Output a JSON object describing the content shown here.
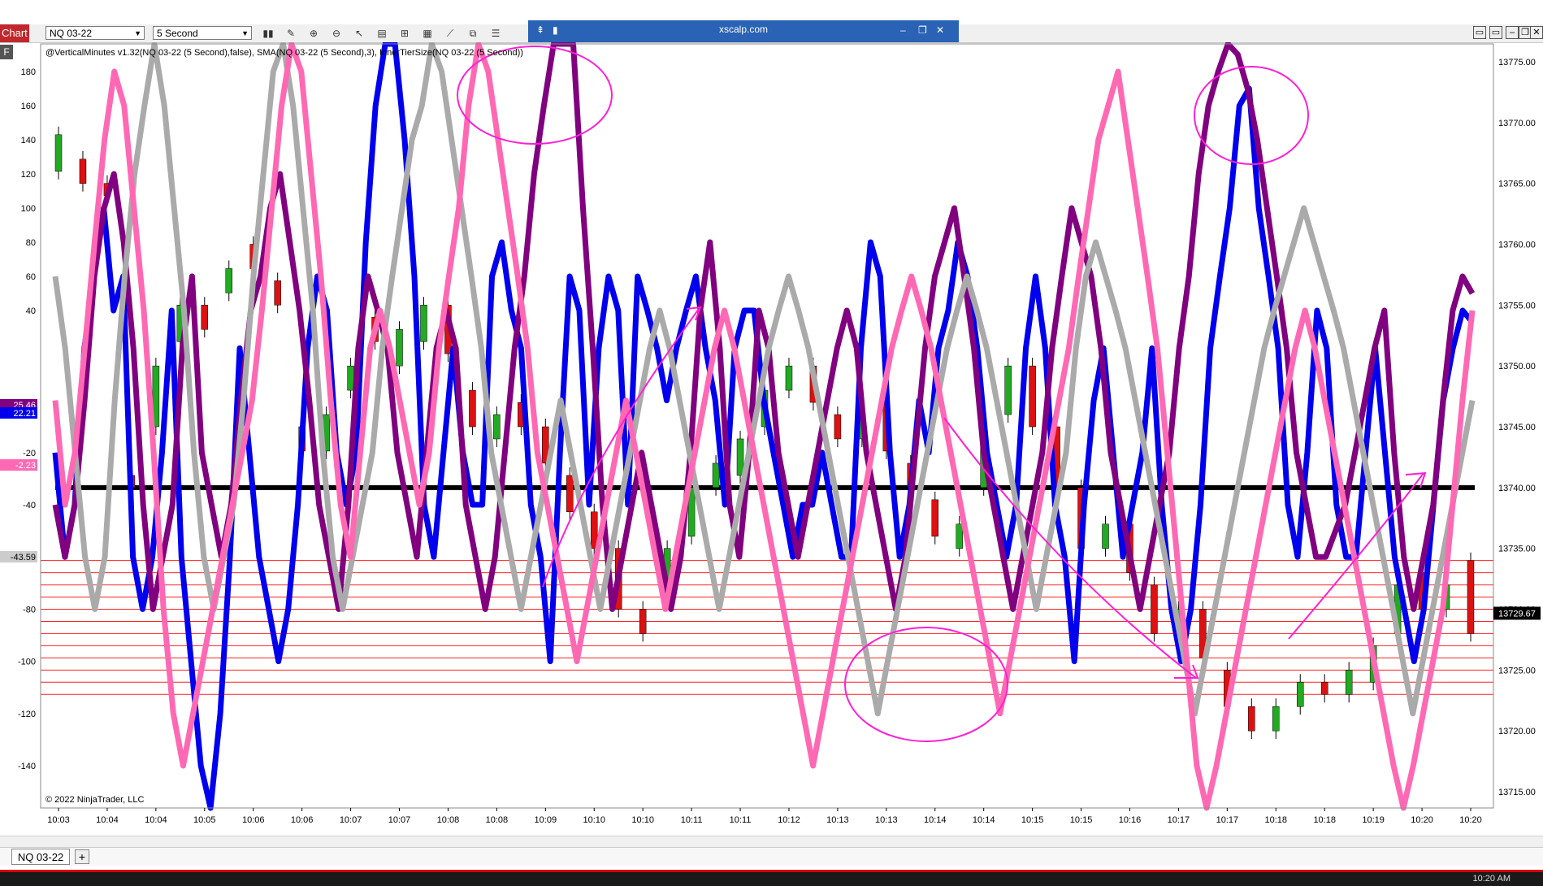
{
  "toolbar": {
    "tab_label": "Chart",
    "instrument": "NQ 03-22",
    "interval": "5 Second"
  },
  "window": {
    "title": "xscalp.com"
  },
  "indicator_label": "@VerticalMinutes v1.32(NQ 03-22 (5 Second),false), SMA(NQ 03-22 (5 Second),3), InnerTierSize(NQ 03-22 (5 Second))",
  "copyright": "© 2022 NinjaTrader, LLC",
  "footer": {
    "instrument_tab": "NQ 03-22",
    "add_tab": "+",
    "clock": "10:20 AM"
  },
  "chart_data": {
    "type": "line",
    "left_axis": {
      "ticks": [
        180,
        160,
        140,
        120,
        100,
        80,
        60,
        40,
        -20,
        -40,
        -60,
        -80,
        -100,
        -120,
        -140
      ]
    },
    "right_axis": {
      "ticks": [
        "13775.00",
        "13770.00",
        "13765.00",
        "13760.00",
        "13755.00",
        "13750.00",
        "13745.00",
        "13740.00",
        "13735.00",
        "13730.00",
        "13725.00",
        "13720.00",
        "13715.00"
      ]
    },
    "x_labels": [
      "10:03",
      "10:04",
      "10:04",
      "10:05",
      "10:06",
      "10:06",
      "10:07",
      "10:07",
      "10:08",
      "10:08",
      "10:09",
      "10:10",
      "10:10",
      "10:11",
      "10:11",
      "10:12",
      "10:13",
      "10:13",
      "10:14",
      "10:14",
      "10:15",
      "10:15",
      "10:16",
      "10:17",
      "10:17",
      "10:18",
      "10:18",
      "10:19",
      "10:20",
      "10:20"
    ],
    "markers": {
      "left": [
        "25.46",
        "22.21",
        "-2.23",
        "-43.59"
      ],
      "right": "13729.67"
    },
    "series": [
      {
        "color": "#0000ee",
        "values": [
          -20,
          -60,
          -40,
          20,
          60,
          100,
          40,
          60,
          -60,
          -80,
          -60,
          -20,
          40,
          -60,
          -100,
          -140,
          -160,
          -120,
          -60,
          20,
          -20,
          -60,
          -80,
          -100,
          -80,
          -40,
          20,
          60,
          40,
          -20,
          -40,
          -20,
          80,
          160,
          200,
          200,
          140,
          60,
          -40,
          -60,
          -20,
          20,
          -20,
          -40,
          -40,
          60,
          80,
          40,
          20,
          -40,
          -60,
          -100,
          -20,
          60,
          40,
          -40,
          20,
          60,
          40,
          -40,
          60,
          40,
          20,
          0,
          20,
          40,
          60,
          20,
          0,
          -40,
          20,
          40,
          40,
          0,
          -20,
          -40,
          -60,
          -40,
          -40,
          -20,
          -40,
          -60,
          -60,
          20,
          80,
          60,
          -20,
          -60,
          -40,
          0,
          -20,
          20,
          40,
          80,
          60,
          20,
          -20,
          -40,
          -60,
          -40,
          20,
          60,
          20,
          -40,
          -60,
          -100,
          -40,
          0,
          20,
          -20,
          -60,
          -40,
          -20,
          20,
          -40,
          -80,
          -100,
          -80,
          -40,
          20,
          60,
          100,
          160,
          170,
          100,
          60,
          20,
          -40,
          -60,
          -20,
          40,
          20,
          -40,
          -60,
          -60,
          -20,
          20,
          -20,
          -60,
          -80,
          -100,
          -80,
          -40,
          0,
          20,
          40,
          30
        ]
      },
      {
        "color": "#800080",
        "values": [
          -40,
          -60,
          -40,
          0,
          60,
          100,
          120,
          80,
          20,
          -40,
          -80,
          -60,
          -40,
          20,
          60,
          -20,
          -40,
          -60,
          -40,
          0,
          40,
          60,
          100,
          120,
          80,
          40,
          0,
          -40,
          -60,
          -80,
          -40,
          20,
          60,
          40,
          20,
          -20,
          -40,
          -60,
          -20,
          20,
          40,
          20,
          -40,
          -60,
          -80,
          -60,
          -20,
          20,
          60,
          120,
          160,
          200,
          220,
          200,
          100,
          20,
          -40,
          -80,
          -60,
          -40,
          -20,
          -40,
          -60,
          -80,
          -60,
          -20,
          40,
          80,
          20,
          -40,
          -60,
          -20,
          40,
          20,
          -20,
          -40,
          -60,
          -40,
          -20,
          0,
          20,
          40,
          20,
          -20,
          -40,
          -60,
          -80,
          -60,
          -20,
          20,
          60,
          80,
          100,
          60,
          20,
          -20,
          -40,
          -60,
          -80,
          -60,
          -40,
          -20,
          20,
          60,
          100,
          80,
          60,
          20,
          -20,
          -40,
          -60,
          -80,
          -60,
          -40,
          -20,
          20,
          60,
          120,
          160,
          180,
          200,
          190,
          170,
          140,
          100,
          60,
          20,
          -20,
          -40,
          -60,
          -60,
          -50,
          -40,
          -20,
          0,
          20,
          40,
          -20,
          -60,
          -80,
          -60,
          -40,
          0,
          40,
          60,
          50
        ]
      },
      {
        "color": "#aaaaaa",
        "values": [
          60,
          20,
          -20,
          -60,
          -80,
          -60,
          0,
          60,
          120,
          160,
          200,
          160,
          100,
          40,
          -20,
          -60,
          -80,
          -60,
          -40,
          0,
          60,
          120,
          180,
          200,
          160,
          100,
          40,
          -20,
          -60,
          -80,
          -60,
          -40,
          -20,
          20,
          60,
          100,
          140,
          160,
          200,
          180,
          140,
          100,
          60,
          20,
          -20,
          -40,
          -60,
          -80,
          -60,
          -40,
          -20,
          0,
          -20,
          -40,
          -60,
          -80,
          -60,
          -40,
          -20,
          0,
          20,
          40,
          20,
          0,
          -20,
          -40,
          -60,
          -80,
          -60,
          -40,
          -20,
          0,
          20,
          40,
          60,
          40,
          20,
          0,
          -20,
          -40,
          -60,
          -80,
          -100,
          -120,
          -100,
          -80,
          -60,
          -40,
          -20,
          0,
          20,
          40,
          60,
          40,
          20,
          0,
          -20,
          -40,
          -60,
          -80,
          -60,
          -40,
          -20,
          20,
          60,
          80,
          60,
          40,
          20,
          0,
          -20,
          -40,
          -60,
          -80,
          -100,
          -120,
          -100,
          -80,
          -60,
          -40,
          -20,
          0,
          20,
          40,
          60,
          80,
          100,
          80,
          60,
          40,
          20,
          0,
          -20,
          -40,
          -60,
          -80,
          -100,
          -120,
          -100,
          -80,
          -60,
          -40,
          -20,
          0
        ]
      },
      {
        "color": "#ff69b4",
        "values": [
          0,
          -40,
          -20,
          20,
          80,
          140,
          180,
          160,
          100,
          40,
          -20,
          -80,
          -120,
          -140,
          -120,
          -100,
          -80,
          -60,
          -40,
          -20,
          0,
          40,
          100,
          160,
          200,
          180,
          120,
          60,
          0,
          -40,
          -60,
          -20,
          20,
          40,
          20,
          0,
          -20,
          -40,
          -20,
          20,
          60,
          100,
          160,
          200,
          180,
          140,
          100,
          60,
          20,
          -20,
          -40,
          -60,
          -80,
          -100,
          -80,
          -60,
          -40,
          -20,
          0,
          -20,
          -40,
          -60,
          -80,
          -60,
          -40,
          -20,
          0,
          20,
          40,
          20,
          0,
          -20,
          -40,
          -60,
          -80,
          -100,
          -120,
          -140,
          -120,
          -100,
          -80,
          -60,
          -40,
          -20,
          0,
          20,
          40,
          60,
          40,
          20,
          0,
          -20,
          -40,
          -60,
          -80,
          -100,
          -120,
          -100,
          -80,
          -60,
          -40,
          -20,
          0,
          20,
          60,
          100,
          140,
          160,
          180,
          140,
          100,
          60,
          20,
          -20,
          -60,
          -100,
          -140,
          -160,
          -140,
          -120,
          -100,
          -80,
          -60,
          -40,
          -20,
          0,
          20,
          40,
          20,
          0,
          -20,
          -40,
          -60,
          -80,
          -100,
          -120,
          -140,
          -160,
          -140,
          -120,
          -100,
          -80,
          -40,
          0,
          40
        ]
      }
    ],
    "candles": [
      {
        "o": 13766,
        "c": 13769
      },
      {
        "o": 13767,
        "c": 13765
      },
      {
        "o": 13765,
        "c": 13764
      },
      {
        "o": 13741,
        "c": 13740
      },
      {
        "o": 13745,
        "c": 13750
      },
      {
        "o": 13752,
        "c": 13755
      },
      {
        "o": 13755,
        "c": 13753
      },
      {
        "o": 13756,
        "c": 13758
      },
      {
        "o": 13760,
        "c": 13758
      },
      {
        "o": 13757,
        "c": 13755
      },
      {
        "o": 13745,
        "c": 13743
      },
      {
        "o": 13743,
        "c": 13746
      },
      {
        "o": 13748,
        "c": 13750
      },
      {
        "o": 13754,
        "c": 13752
      },
      {
        "o": 13750,
        "c": 13753
      },
      {
        "o": 13752,
        "c": 13755
      },
      {
        "o": 13755,
        "c": 13751
      },
      {
        "o": 13748,
        "c": 13745
      },
      {
        "o": 13744,
        "c": 13746
      },
      {
        "o": 13747,
        "c": 13745
      },
      {
        "o": 13745,
        "c": 13742
      },
      {
        "o": 13741,
        "c": 13738
      },
      {
        "o": 13738,
        "c": 13735
      },
      {
        "o": 13735,
        "c": 13730
      },
      {
        "o": 13730,
        "c": 13728
      },
      {
        "o": 13732,
        "c": 13735
      },
      {
        "o": 13736,
        "c": 13740
      },
      {
        "o": 13740,
        "c": 13742
      },
      {
        "o": 13741,
        "c": 13744
      },
      {
        "o": 13745,
        "c": 13748
      },
      {
        "o": 13748,
        "c": 13750
      },
      {
        "o": 13750,
        "c": 13747
      },
      {
        "o": 13746,
        "c": 13744
      },
      {
        "o": 13744,
        "c": 13746
      },
      {
        "o": 13747,
        "c": 13743
      },
      {
        "o": 13742,
        "c": 13740
      },
      {
        "o": 13739,
        "c": 13736
      },
      {
        "o": 13735,
        "c": 13737
      },
      {
        "o": 13740,
        "c": 13745
      },
      {
        "o": 13746,
        "c": 13750
      },
      {
        "o": 13750,
        "c": 13745
      },
      {
        "o": 13745,
        "c": 13740
      },
      {
        "o": 13740,
        "c": 13735
      },
      {
        "o": 13735,
        "c": 13737
      },
      {
        "o": 13737,
        "c": 13733
      },
      {
        "o": 13732,
        "c": 13728
      },
      {
        "o": 13728,
        "c": 13730
      },
      {
        "o": 13730,
        "c": 13726
      },
      {
        "o": 13725,
        "c": 13722
      },
      {
        "o": 13722,
        "c": 13720
      },
      {
        "o": 13720,
        "c": 13722
      },
      {
        "o": 13722,
        "c": 13724
      },
      {
        "o": 13724,
        "c": 13723
      },
      {
        "o": 13723,
        "c": 13725
      },
      {
        "o": 13724,
        "c": 13727
      },
      {
        "o": 13728,
        "c": 13732
      },
      {
        "o": 13733,
        "c": 13730
      },
      {
        "o": 13730,
        "c": 13732
      },
      {
        "o": 13734,
        "c": 13728
      }
    ],
    "levels": {
      "zero_line": 13740,
      "red_lines": [
        13734,
        13733,
        13732,
        13731,
        13730,
        13729,
        13728,
        13727,
        13726,
        13725,
        13724,
        13723
      ]
    }
  }
}
